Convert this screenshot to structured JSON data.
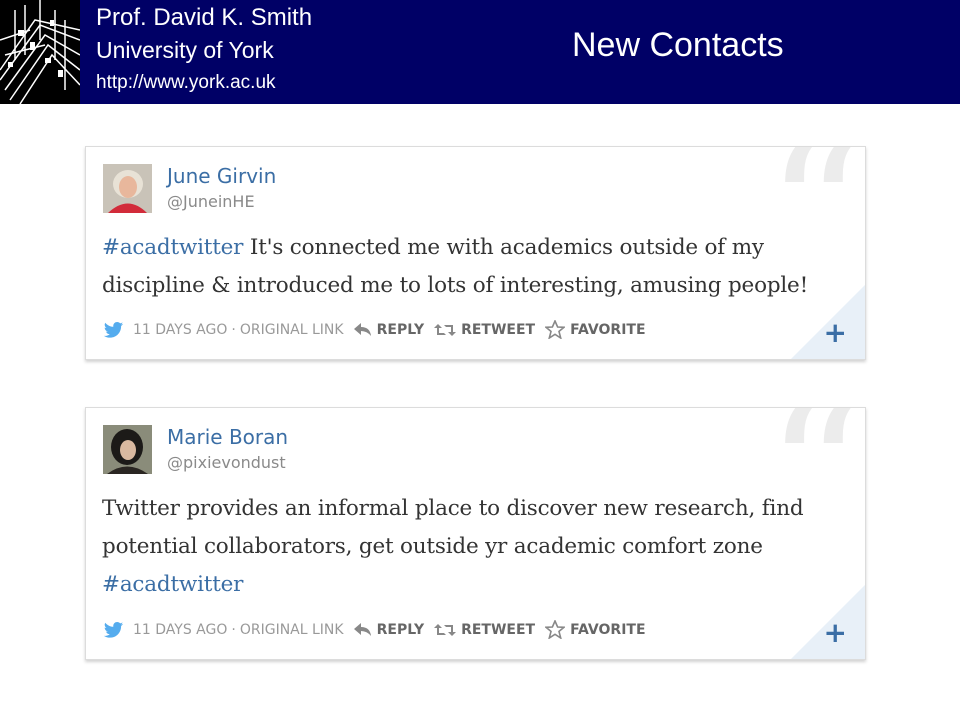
{
  "header": {
    "author": "Prof. David K. Smith",
    "university": "University of York",
    "url": "http://www.york.ac.uk",
    "title": "New Contacts"
  },
  "colors": {
    "banner": "#000066",
    "link": "#3b6ea5",
    "twitter_bird": "#55acee"
  },
  "tweets": [
    {
      "name": "June Girvin",
      "handle": "@JuneinHE",
      "hashtag": "#acadtwitter",
      "text_after": " It's connected me with academics outside of my discipline & introduced me to lots of interesting, amusing people!",
      "time": "11 DAYS AGO",
      "original_link": "ORIGINAL LINK",
      "reply": "REPLY",
      "retweet": "RETWEET",
      "favorite": "FAVORITE"
    },
    {
      "name": "Marie Boran",
      "handle": "@pixievondust",
      "text_before": "Twitter provides an informal place to discover new research, find potential collaborators, get outside yr academic comfort zone ",
      "hashtag": "#acadtwitter",
      "time": "11 DAYS AGO",
      "original_link": "ORIGINAL LINK",
      "reply": "REPLY",
      "retweet": "RETWEET",
      "favorite": "FAVORITE"
    }
  ]
}
